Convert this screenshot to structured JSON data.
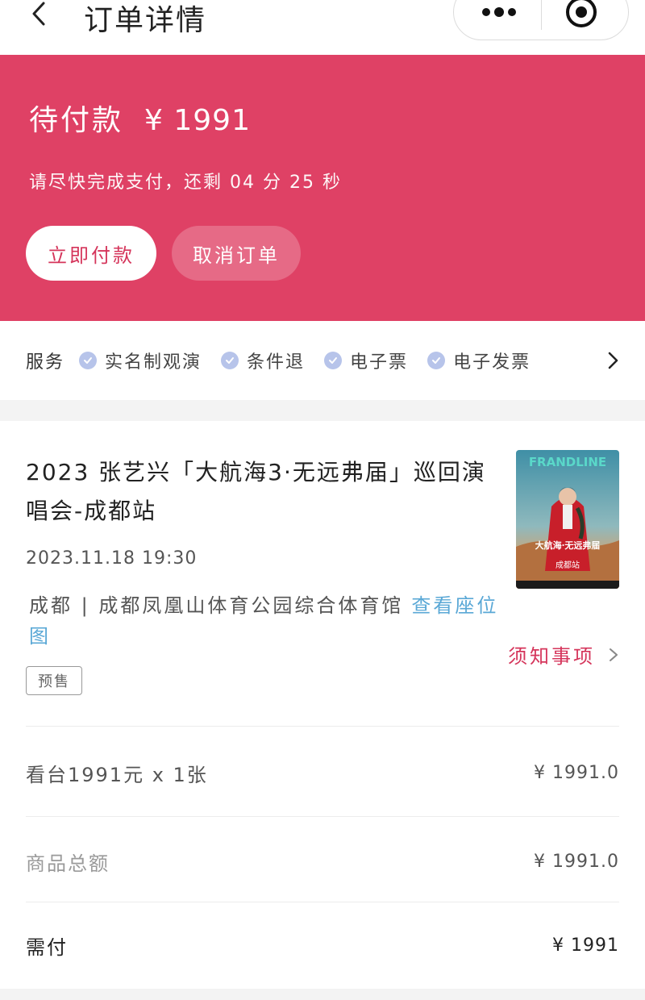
{
  "nav": {
    "title": "订单详情",
    "icons": {
      "back": "chevron-left-icon",
      "more": "more-dots-icon",
      "close": "target-close-icon"
    }
  },
  "banner": {
    "status": "待付款",
    "amount": "¥ 1991",
    "countdown": "请尽快完成支付，还剩 04 分 25 秒",
    "pay_button": "立即付款",
    "cancel_button": "取消订单",
    "color": "#df4165"
  },
  "services": {
    "label": "服务",
    "items": [
      {
        "label": "实名制观演"
      },
      {
        "label": "条件退"
      },
      {
        "label": "电子票"
      },
      {
        "label": "电子发票"
      }
    ]
  },
  "order": {
    "title": "2023 张艺兴「大航海3·无远弗届」巡回演唱会-成都站",
    "datetime": "2023.11.18 19:30",
    "venue": "成都 | 成都凤凰山体育公园综合体育馆",
    "seat_map_link": "查看座位图",
    "tag": "预售",
    "notice": "须知事项",
    "poster": {
      "top_text": "FRANDLINE",
      "headline": "大航海·无远弗届",
      "city": "成都站"
    }
  },
  "summary": {
    "ticket_label": "看台1991元 x 1张",
    "ticket_value": "¥ 1991.0",
    "total_label": "商品总额",
    "total_value": "¥ 1991.0",
    "due_label": "需付",
    "due_value": "¥ 1991"
  },
  "colors": {
    "accent": "#d5355b",
    "link": "#5aa8d6",
    "check": "#b7c4ea"
  }
}
